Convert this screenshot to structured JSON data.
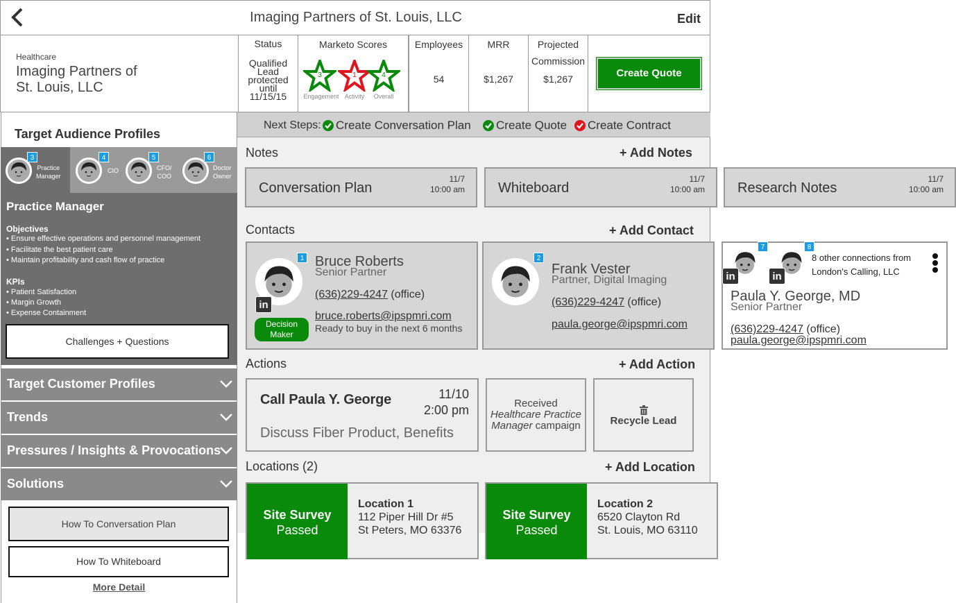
{
  "header": {
    "title": "Imaging Partners of St. Louis, LLC",
    "edit_label": "Edit"
  },
  "company": {
    "industry": "Healthcare",
    "name_line1": "Imaging Partners of",
    "name_line2": "St. Louis, LLC"
  },
  "stats": {
    "status_label": "Status",
    "status_value": [
      "Qualified",
      "Lead",
      "protected",
      "until",
      "11/15/15"
    ],
    "marketo_label": "Marketo Scores",
    "scores": [
      {
        "value": "3",
        "label": "Engagement",
        "color": "#0a8a0a"
      },
      {
        "value": "1",
        "label": "Activity",
        "color": "#e0161e"
      },
      {
        "value": "4",
        "label": "Overall",
        "color": "#0a8a0a"
      }
    ],
    "employees_label": "Employees",
    "employees_value": "54",
    "mrr_label": "MRR",
    "mrr_value": "$1,267",
    "projected_label1": "Projected",
    "projected_label2": "Commission",
    "projected_value": "$1,267"
  },
  "create_quote_label": "Create Quote",
  "next_steps": {
    "label": "Next Steps:",
    "steps": [
      {
        "text": "Create Conversation Plan",
        "status": "done"
      },
      {
        "text": "Create Quote",
        "status": "done"
      },
      {
        "text": "Create Contract",
        "status": "pending"
      }
    ]
  },
  "sidebar": {
    "section_title": "Target Audience Profiles",
    "profiles": [
      {
        "badge": "3",
        "label1": "Practice",
        "label2": "Manager"
      },
      {
        "badge": "4",
        "label1": "CIO",
        "label2": ""
      },
      {
        "badge": "5",
        "label1": "CFO/",
        "label2": "COO"
      },
      {
        "badge": "6",
        "label1": "Doctor",
        "label2": "Owner"
      }
    ],
    "profile_title": "Practice Manager",
    "objectives_title": "Objectives",
    "objectives": [
      "• Ensure effective operations and personnel management",
      "• Facilitate the best patient care",
      "• Maintain profitability and cash flow of practice"
    ],
    "kpis_title": "KPIs",
    "kpis": [
      "•  Patient Satisfaction",
      "• Margin Growth",
      "• Expense Containment"
    ],
    "challenges_label": "Challenges + Questions",
    "accordions": [
      "Target Customer Profiles",
      "Trends",
      "Pressures / Insights & Provocations",
      "Solutions"
    ],
    "how_to_conv": "How To Conversation Plan",
    "how_to_wb": "How To Whiteboard",
    "more_detail": "More Detail"
  },
  "notes": {
    "title": "Notes",
    "add": "+ Add Notes",
    "items": [
      {
        "title": "Conversation Plan",
        "date": "11/7",
        "time": "10:00 am"
      },
      {
        "title": "Whiteboard",
        "date": "11/7",
        "time": "10:00 am"
      },
      {
        "title": "Research Notes",
        "date": "11/7",
        "time": "10:00 am"
      }
    ]
  },
  "contacts": {
    "title": "Contacts",
    "add": "+ Add Contact",
    "items": [
      {
        "badge": "1",
        "name": "Bruce Roberts",
        "role": "Senior Partner",
        "phone": "(636)229-4247",
        "phone_type": "(office)",
        "email": "bruce.roberts@ipspmri.com",
        "note": "Ready to buy in the next 6 months",
        "tag1": "Decision",
        "tag2": "Maker"
      },
      {
        "badge": "2",
        "name": "Frank Vester",
        "role": "Partner, Digital Imaging",
        "phone": "(636)229-4247",
        "phone_type": "(office)",
        "email": "paula.george@ipspmri.com"
      }
    ],
    "connection": {
      "badges": [
        "7",
        "8"
      ],
      "other_line1": "8 other connections from",
      "other_line2": "London's Calling, LLC",
      "name": "Paula Y. George, MD",
      "role": "Senior Partner",
      "phone": "(636)229-4247",
      "phone_type": "(office)",
      "email": "paula.george@ipspmri.com"
    }
  },
  "actions": {
    "title": "Actions",
    "add": "+ Add Action",
    "call": {
      "title": "Call Paula Y. George",
      "date": "11/10",
      "time": "2:00 pm",
      "desc": "Discuss Fiber Product, Benefits"
    },
    "received": {
      "line1": "Received",
      "line2": "Healthcare Practice",
      "line3a": "Manager",
      "line3b": "campaign"
    },
    "recycle": "Recycle Lead"
  },
  "locations": {
    "title": "Locations (2)",
    "add": "+ Add Location",
    "items": [
      {
        "status1": "Site Survey",
        "status2": "Passed",
        "name": "Location 1",
        "addr1": "112 Piper Hill Dr #5",
        "addr2": "St Peters, MO 63376"
      },
      {
        "status1": "Site Survey",
        "status2": "Passed",
        "name": "Location 2",
        "addr1": "6520 Clayton Rd",
        "addr2": "St. Louis, MO 63110"
      }
    ]
  }
}
